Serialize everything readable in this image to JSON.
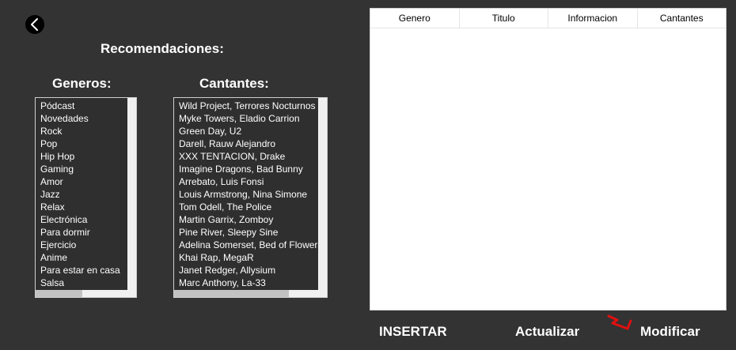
{
  "title": "Recomendaciones:",
  "generos": {
    "heading": "Generos:",
    "items": [
      "Pódcast",
      "Novedades",
      "Rock",
      "Pop",
      "Hip Hop",
      "Gaming",
      "Amor",
      "Jazz",
      "Relax",
      "Electrónica",
      "Para dormir",
      "Ejercicio",
      "Anime",
      "Para estar en casa",
      "Salsa"
    ]
  },
  "cantantes": {
    "heading": "Cantantes:",
    "items": [
      "Wild Project, Terrores Nocturnos",
      "Myke Towers, Eladio Carrion",
      "Green Day, U2",
      "Darell, Rauw Alejandro",
      "XXX TENTACION, Drake",
      "Imagine Dragons, Bad Bunny",
      "Arrebato, Luis Fonsi",
      "Louis Armstrong, Nina Simone",
      "Tom Odell, The Police",
      "Martin Garrix, Zomboy",
      "Pine River, Sleepy Sine",
      "Adelina Somerset, Bed of Flowers",
      "Khai Rap, MegaR",
      "Janet Redger, Allysium",
      "Marc Anthony, La-33"
    ]
  },
  "grid": {
    "columns": [
      "Genero",
      "Titulo",
      "Informacion",
      "Cantantes"
    ]
  },
  "actions": {
    "insertar": "INSERTAR",
    "actualizar": "Actualizar",
    "modificar": "Modificar"
  },
  "icons": {
    "back": "chevron-left-icon",
    "annotation": "red-arrow-mark"
  },
  "colors": {
    "background": "#333333",
    "annotation": "#e01010"
  }
}
